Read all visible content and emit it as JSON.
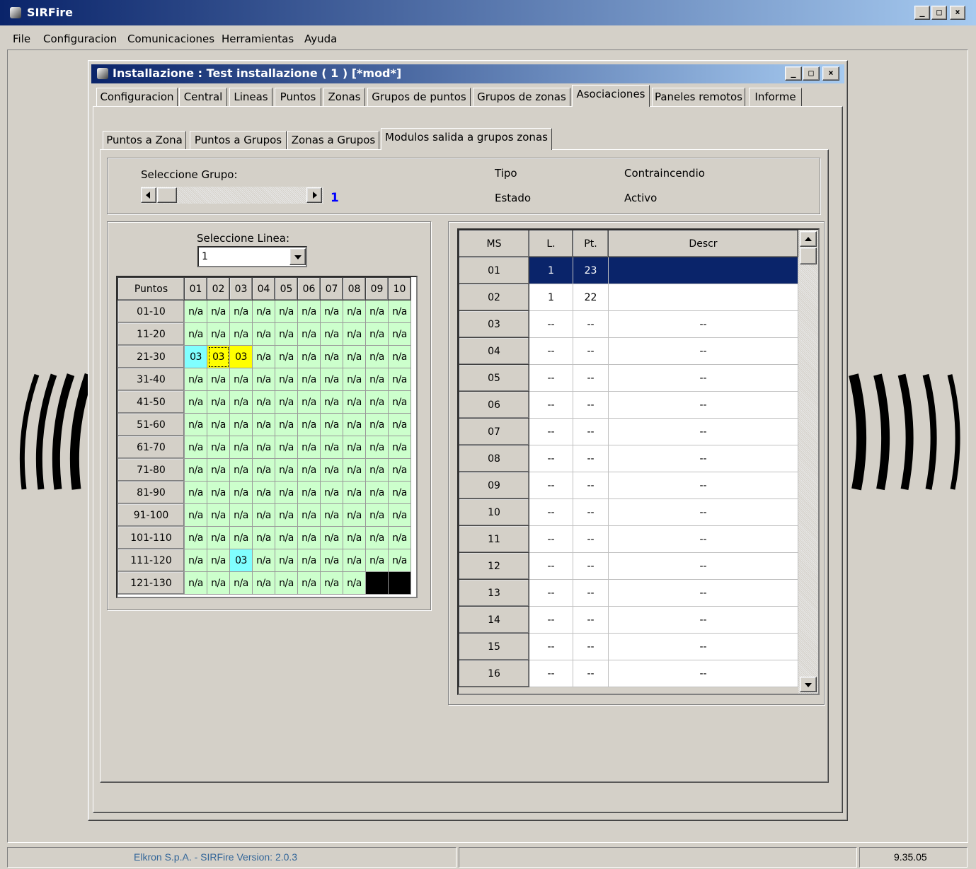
{
  "app": {
    "title": "SIRFire"
  },
  "menu": [
    "File",
    "Configuracion",
    "Comunicaciones",
    "Herramientas",
    "Ayuda"
  ],
  "child_window": {
    "title": "Installazione : Test installazione  ( 1 )  [*mod*]"
  },
  "tabs": [
    "Configuracion",
    "Central",
    "Lineas",
    "Puntos",
    "Zonas",
    "Grupos de puntos",
    "Grupos de zonas",
    "Asociaciones",
    "Paneles remotos",
    "Informe"
  ],
  "active_tab": "Asociaciones",
  "subtabs": [
    "Puntos a Zona",
    "Puntos a Grupos",
    "Zonas a Grupos",
    "Modulos salida a grupos zonas"
  ],
  "active_subtab": "Modulos salida a grupos zonas",
  "group_panel": {
    "select_label": "Seleccione Grupo:",
    "group_value": "1",
    "tipo_label": "Tipo",
    "tipo_value": "Contraincendio",
    "estado_label": "Estado",
    "estado_value": "Activo"
  },
  "line_select": {
    "label": "Seleccione Linea:",
    "value": "1"
  },
  "points_grid": {
    "corner": "Puntos",
    "columns": [
      "01",
      "02",
      "03",
      "04",
      "05",
      "06",
      "07",
      "08",
      "09",
      "10"
    ],
    "rows": [
      {
        "label": "01-10",
        "cells": [
          "n/a",
          "n/a",
          "n/a",
          "n/a",
          "n/a",
          "n/a",
          "n/a",
          "n/a",
          "n/a",
          "n/a"
        ]
      },
      {
        "label": "11-20",
        "cells": [
          "n/a",
          "n/a",
          "n/a",
          "n/a",
          "n/a",
          "n/a",
          "n/a",
          "n/a",
          "n/a",
          "n/a"
        ]
      },
      {
        "label": "21-30",
        "cells": [
          "03",
          "03",
          "03",
          "n/a",
          "n/a",
          "n/a",
          "n/a",
          "n/a",
          "n/a",
          "n/a"
        ]
      },
      {
        "label": "31-40",
        "cells": [
          "n/a",
          "n/a",
          "n/a",
          "n/a",
          "n/a",
          "n/a",
          "n/a",
          "n/a",
          "n/a",
          "n/a"
        ]
      },
      {
        "label": "41-50",
        "cells": [
          "n/a",
          "n/a",
          "n/a",
          "n/a",
          "n/a",
          "n/a",
          "n/a",
          "n/a",
          "n/a",
          "n/a"
        ]
      },
      {
        "label": "51-60",
        "cells": [
          "n/a",
          "n/a",
          "n/a",
          "n/a",
          "n/a",
          "n/a",
          "n/a",
          "n/a",
          "n/a",
          "n/a"
        ]
      },
      {
        "label": "61-70",
        "cells": [
          "n/a",
          "n/a",
          "n/a",
          "n/a",
          "n/a",
          "n/a",
          "n/a",
          "n/a",
          "n/a",
          "n/a"
        ]
      },
      {
        "label": "71-80",
        "cells": [
          "n/a",
          "n/a",
          "n/a",
          "n/a",
          "n/a",
          "n/a",
          "n/a",
          "n/a",
          "n/a",
          "n/a"
        ]
      },
      {
        "label": "81-90",
        "cells": [
          "n/a",
          "n/a",
          "n/a",
          "n/a",
          "n/a",
          "n/a",
          "n/a",
          "n/a",
          "n/a",
          "n/a"
        ]
      },
      {
        "label": "91-100",
        "cells": [
          "n/a",
          "n/a",
          "n/a",
          "n/a",
          "n/a",
          "n/a",
          "n/a",
          "n/a",
          "n/a",
          "n/a"
        ]
      },
      {
        "label": "101-110",
        "cells": [
          "n/a",
          "n/a",
          "n/a",
          "n/a",
          "n/a",
          "n/a",
          "n/a",
          "n/a",
          "n/a",
          "n/a"
        ]
      },
      {
        "label": "111-120",
        "cells": [
          "n/a",
          "n/a",
          "03",
          "n/a",
          "n/a",
          "n/a",
          "n/a",
          "n/a",
          "n/a",
          "n/a"
        ]
      },
      {
        "label": "121-130",
        "cells": [
          "n/a",
          "n/a",
          "n/a",
          "n/a",
          "n/a",
          "n/a",
          "n/a",
          "n/a",
          "",
          ""
        ]
      }
    ],
    "cell_colors": {
      "default": "#ccffcc",
      "cyan": "#80ffff",
      "yellow": "#ffff00",
      "disabled": "#000000"
    },
    "styles": {
      "2": [
        "cyan",
        "yellow",
        "yellow"
      ],
      "11": [
        "",
        "",
        "cyan"
      ],
      "12": [
        "",
        "",
        "",
        "",
        "",
        "",
        "",
        "",
        "black",
        "black"
      ]
    }
  },
  "ms_grid": {
    "headers": [
      "MS",
      "L.",
      "Pt.",
      "Descr"
    ],
    "rows": [
      {
        "ms": "01",
        "l": "1",
        "pt": "23",
        "descr": ""
      },
      {
        "ms": "02",
        "l": "1",
        "pt": "22",
        "descr": ""
      },
      {
        "ms": "03",
        "l": "--",
        "pt": "--",
        "descr": "--"
      },
      {
        "ms": "04",
        "l": "--",
        "pt": "--",
        "descr": "--"
      },
      {
        "ms": "05",
        "l": "--",
        "pt": "--",
        "descr": "--"
      },
      {
        "ms": "06",
        "l": "--",
        "pt": "--",
        "descr": "--"
      },
      {
        "ms": "07",
        "l": "--",
        "pt": "--",
        "descr": "--"
      },
      {
        "ms": "08",
        "l": "--",
        "pt": "--",
        "descr": "--"
      },
      {
        "ms": "09",
        "l": "--",
        "pt": "--",
        "descr": "--"
      },
      {
        "ms": "10",
        "l": "--",
        "pt": "--",
        "descr": "--"
      },
      {
        "ms": "11",
        "l": "--",
        "pt": "--",
        "descr": "--"
      },
      {
        "ms": "12",
        "l": "--",
        "pt": "--",
        "descr": "--"
      },
      {
        "ms": "13",
        "l": "--",
        "pt": "--",
        "descr": "--"
      },
      {
        "ms": "14",
        "l": "--",
        "pt": "--",
        "descr": "--"
      },
      {
        "ms": "15",
        "l": "--",
        "pt": "--",
        "descr": "--"
      },
      {
        "ms": "16",
        "l": "--",
        "pt": "--",
        "descr": "--"
      }
    ],
    "selected_row": 0
  },
  "statusbar": {
    "company": "Elkron S.p.A.  -  SIRFire  Version: 2.0.3",
    "version": "9.35.05"
  },
  "colors": {
    "title_active": "#0a246a",
    "title_gradient_end": "#a6caf0",
    "selection": "#0a246a",
    "status_text": "#336699"
  },
  "icons": [
    "app-icon",
    "minimize-icon",
    "maximize-icon",
    "close-icon",
    "scroll-left-icon",
    "scroll-right-icon",
    "dropdown-arrow-icon",
    "scroll-up-icon",
    "scroll-down-icon"
  ]
}
